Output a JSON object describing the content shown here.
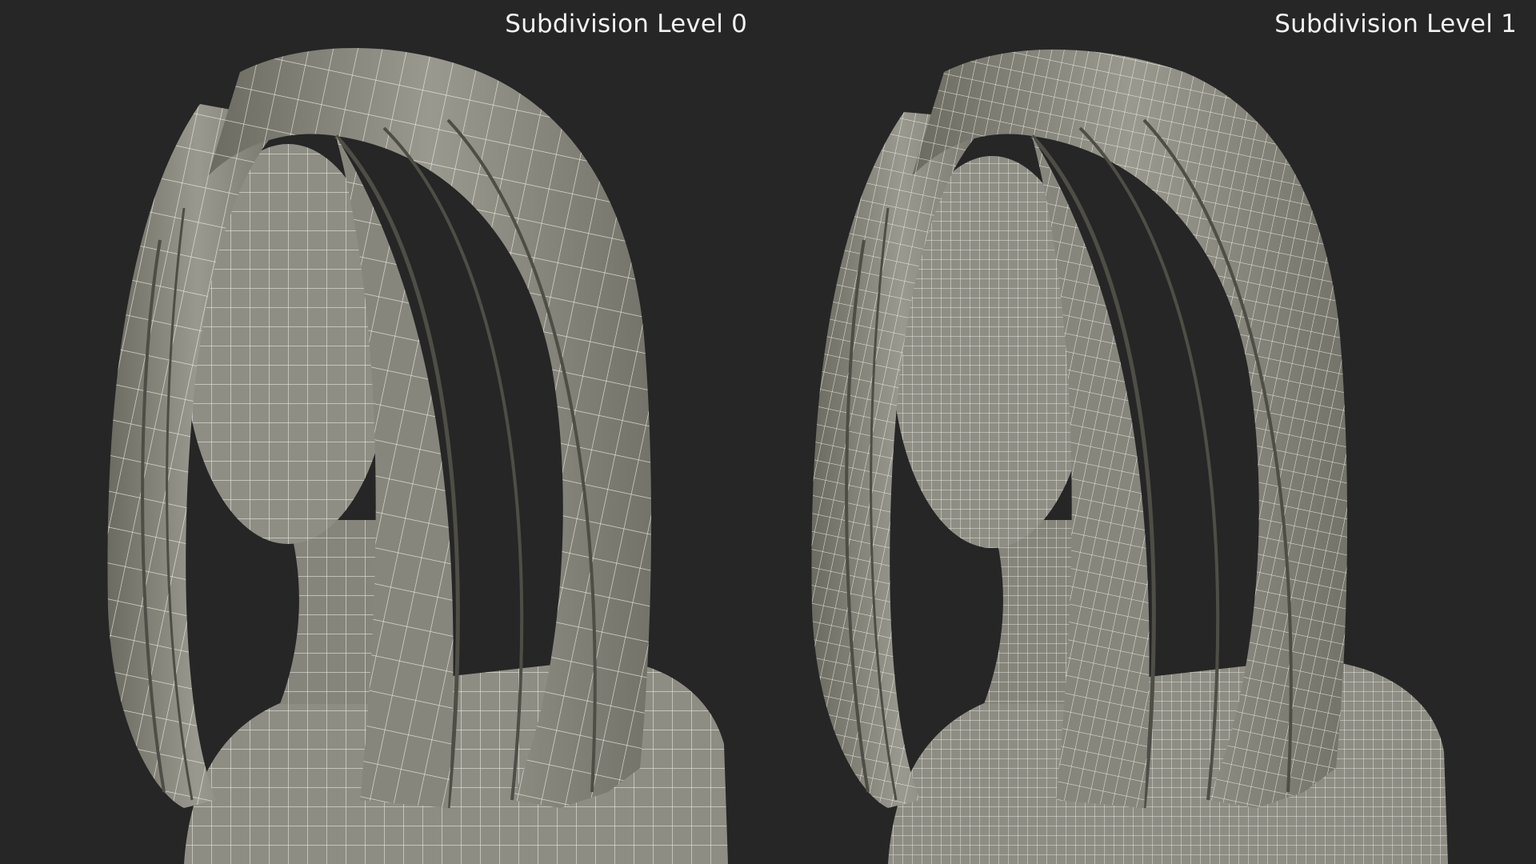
{
  "panels": [
    {
      "label": "Subdivision Level 0"
    },
    {
      "label": "Subdivision Level 1"
    }
  ],
  "colors": {
    "background": "#262626",
    "mesh_fill": "#8d8c82",
    "mesh_shadow": "#5a5a52",
    "wire": "#f4f4ec",
    "label": "#f2f2f2"
  }
}
